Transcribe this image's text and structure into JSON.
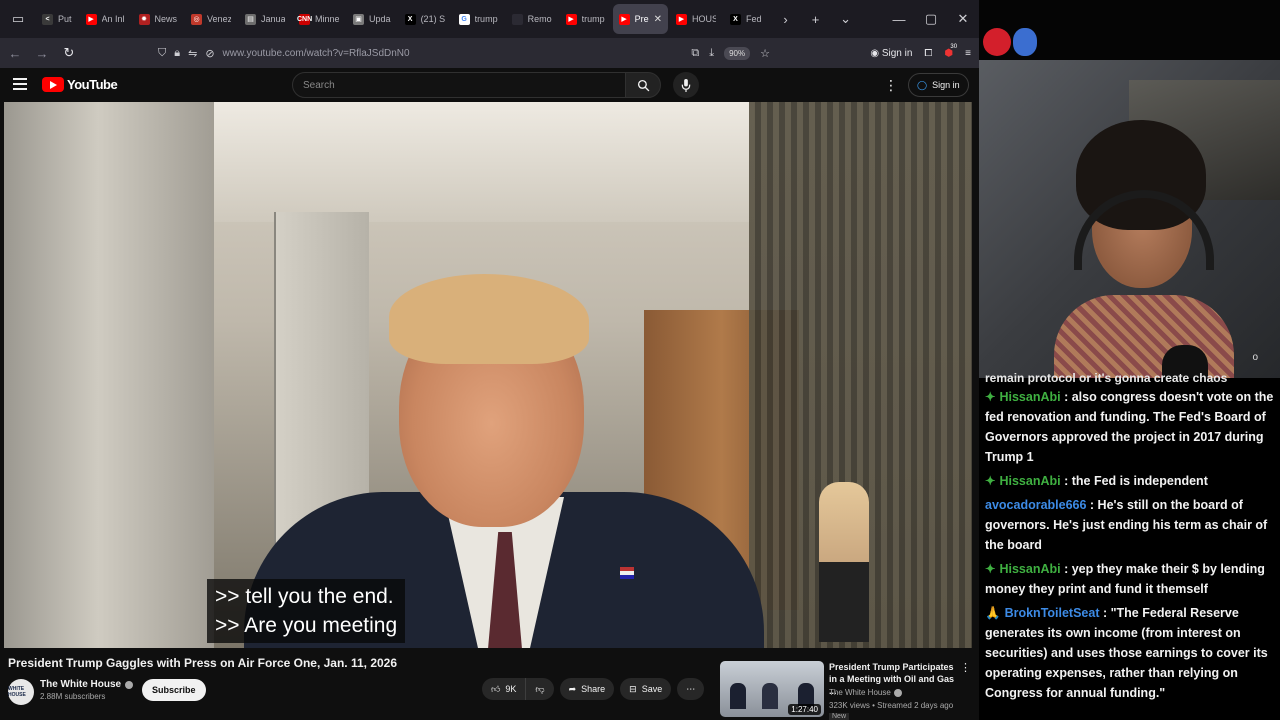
{
  "browser": {
    "tabs": [
      {
        "label": "Put",
        "fav_color": "#3a3a3a",
        "fav_glyph": "<"
      },
      {
        "label": "An Inl",
        "fav_color": "#ff0000",
        "fav_glyph": "▶"
      },
      {
        "label": "News",
        "fav_color": "#b02020",
        "fav_glyph": "✹"
      },
      {
        "label": "Venez",
        "fav_color": "#c0392b",
        "fav_glyph": "◎"
      },
      {
        "label": "Janua",
        "fav_color": "#6d6d6d",
        "fav_glyph": "▤"
      },
      {
        "label": "Minne",
        "fav_color": "#cc0000",
        "fav_glyph": "CNN"
      },
      {
        "label": "Upda",
        "fav_color": "#7a7a7a",
        "fav_glyph": "▣"
      },
      {
        "label": "(21) S",
        "fav_color": "#000000",
        "fav_glyph": "X"
      },
      {
        "label": "trump",
        "fav_color": "#ffffff",
        "fav_glyph": "G"
      },
      {
        "label": "Remo",
        "fav_color": "#2b2a33",
        "fav_glyph": ""
      },
      {
        "label": "trump",
        "fav_color": "#ff0000",
        "fav_glyph": "▶"
      },
      {
        "label": "Pre",
        "fav_color": "#ff0000",
        "fav_glyph": "▶",
        "active": true
      },
      {
        "label": "HOUS",
        "fav_color": "#ff0000",
        "fav_glyph": "▶"
      },
      {
        "label": "Fed",
        "fav_color": "#000000",
        "fav_glyph": "X"
      }
    ],
    "url": "www.youtube.com/watch?v=RflaJSdDnN0",
    "zoom": "90%",
    "sign_in": "Sign in",
    "notif_count": "30"
  },
  "youtube": {
    "logo_text": "YouTube",
    "search_placeholder": "Search",
    "sign_in": "Sign in",
    "caption_lines": [
      ">> tell you the end.",
      ">> Are you meeting"
    ],
    "title": "President Trump Gaggles with Press on Air Force One, Jan. 11, 2026",
    "channel": "The White House",
    "channel_avatar_text": "WHITE HOUSE",
    "subscribers": "2.88M subscribers",
    "subscribe_label": "Subscribe",
    "likes": "9K",
    "share_label": "Share",
    "save_label": "Save",
    "recommended": {
      "title": "President Trump Participates in a Meeting with Oil and Gas ...",
      "channel": "The White House",
      "meta": "323K views • Streamed 2 days ago",
      "duration": "1:27:40",
      "badge": "New"
    }
  },
  "stream": {
    "cam_overlay_text": "o",
    "chat_cutoff": "remain protocol or it's gonna create chaos",
    "messages": [
      {
        "badge": "✦",
        "user": "HissanAbi",
        "text": " : also congress doesn't vote on the fed renovation and funding. The Fed's Board of Governors approved the project in 2017 during Trump 1",
        "color": "green"
      },
      {
        "badge": "✦",
        "user": "HissanAbi",
        "text": " : the Fed is independent",
        "color": "green"
      },
      {
        "badge": "",
        "user": "avocadorable666",
        "text": " : He's still on the board of governors. He's just ending his term as chair of the board",
        "color": "blue"
      },
      {
        "badge": "✦",
        "user": "HissanAbi",
        "text": " : yep they make their $ by lending money they print and fund it themself",
        "color": "green"
      },
      {
        "badge": "🙏",
        "user": "BroknToiletSeat",
        "text": " : \"The Federal Reserve generates its own income (from interest on securities) and uses those earnings to cover its operating expenses, rather than relying on Congress for annual funding.\"",
        "color": "blue"
      }
    ]
  }
}
